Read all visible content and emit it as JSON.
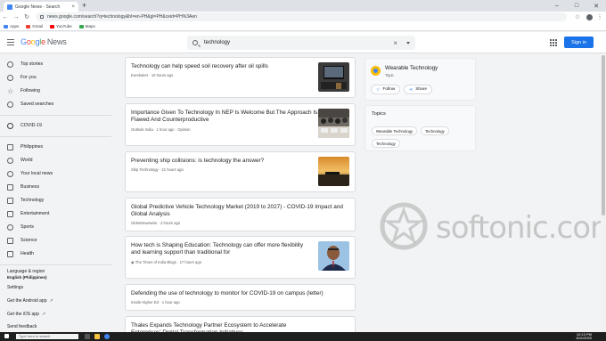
{
  "browser": {
    "tab_title": "Google News - Search",
    "tab_close": "×",
    "new_tab": "+",
    "url": "news.google.com/search?q=technology&hl=en-PH&gl=PH&ceid=PH%3Aen",
    "bookmarks": [
      {
        "label": "Apps",
        "color": "#4285f4"
      },
      {
        "label": "Gmail",
        "color": "#ea4335"
      },
      {
        "label": "YouTube",
        "color": "#ff0000"
      },
      {
        "label": "Maps",
        "color": "#34a853"
      }
    ]
  },
  "header": {
    "logo_google": [
      "G",
      "o",
      "o",
      "g",
      "l",
      "e"
    ],
    "logo_news": "News",
    "search_value": "technology",
    "clear": "×",
    "signin_label": "Sign in"
  },
  "sidebar": {
    "items": [
      {
        "label": "Top stories",
        "icon": "globe-icon"
      },
      {
        "label": "For you",
        "icon": "person-icon"
      },
      {
        "label": "Following",
        "icon": "star-icon"
      },
      {
        "label": "Saved searches",
        "icon": "search-icon"
      }
    ],
    "covid": "COVID-19",
    "sections": [
      {
        "label": "Philippines",
        "icon": "flag-icon"
      },
      {
        "label": "World",
        "icon": "globe-icon"
      },
      {
        "label": "Your local news",
        "icon": "location-icon"
      },
      {
        "label": "Business",
        "icon": "building-icon"
      },
      {
        "label": "Technology",
        "icon": "chip-icon"
      },
      {
        "label": "Entertainment",
        "icon": "film-icon"
      },
      {
        "label": "Sports",
        "icon": "bike-icon"
      },
      {
        "label": "Science",
        "icon": "flask-icon"
      },
      {
        "label": "Health",
        "icon": "health-icon"
      }
    ],
    "language_label": "Language & region",
    "language_value": "English (Philippines)",
    "settings": "Settings",
    "android": "Get the Android app",
    "ios": "Get the iOS app",
    "feedback": "Send feedback",
    "ext": "↗"
  },
  "articles": [
    {
      "title": "Technology can help speed soil recovery after oil spills",
      "source": "Eurekalert",
      "time": "10 hours ago",
      "thumb": "dark-screen"
    },
    {
      "title": "Importance Given To Technology In NEP Is Welcome But The Approach Is Flawed And Counterproductive",
      "source": "Outlook India",
      "time": "1 hour ago",
      "extra": "Opinion",
      "thumb": "classroom"
    },
    {
      "title": "Preventing ship collisions: is technology the answer?",
      "source": "Ship Technology",
      "time": "21 hours ago",
      "thumb": "sunset"
    },
    {
      "title": "Global Predictive Vehicle Technology Market (2019 to 2027) - COVID-19 Impact and Global Analysis",
      "source": "GlobeNewswire",
      "time": "2 hours ago"
    },
    {
      "title": "How tech is Shaping Education: Technology can offer more flexibility and learning support than traditional for",
      "source": "The Times of India Blogs",
      "time": "17 hours ago",
      "thumb": "portrait"
    },
    {
      "title": "Defending the use of technology to monitor for COVID-19 on campus (letter)",
      "source": "Inside Higher Ed",
      "time": "1 hour ago"
    },
    {
      "title": "Thales Expands Technology Partner Ecosystem to Accelerate Enterprises' Digital Transformation Initiatives"
    }
  ],
  "topic": {
    "name": "Wearable Technology",
    "type": "Topic",
    "follow": "Follow",
    "share": "Share"
  },
  "topics": {
    "heading": "Topics",
    "chips": [
      "Wearable Technology",
      "Technology",
      "Technology"
    ]
  },
  "watermark": "softonic.com",
  "taskbar": {
    "search_placeholder": "Type here to search",
    "time": "10:13 PM",
    "date": "8/11/2020"
  }
}
